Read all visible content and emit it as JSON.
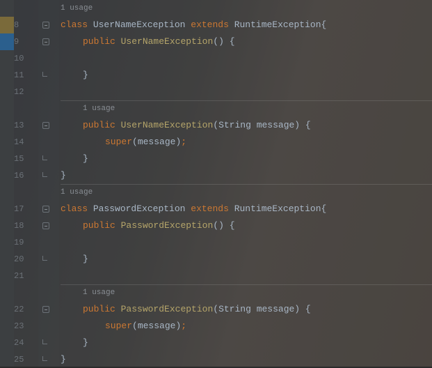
{
  "usage_label": "1 usage",
  "tokens": {
    "class": "class",
    "extends": "extends",
    "public": "public",
    "super": "super",
    "UserNameException": "UserNameException",
    "PasswordException": "PasswordException",
    "RuntimeException": "RuntimeException",
    "String": "String",
    "message": "message",
    "lparen": "(",
    "rparen": ")",
    "lbrace": "{",
    "rbrace": "}",
    "semi": ";",
    "space": " "
  },
  "line_numbers": {
    "l8": "8",
    "l9": "9",
    "l10": "10",
    "l11": "11",
    "l12": "12",
    "l13": "13",
    "l14": "14",
    "l15": "15",
    "l16": "16",
    "l17": "17",
    "l18": "18",
    "l19": "19",
    "l20": "20",
    "l21": "21",
    "l22": "22",
    "l23": "23",
    "l24": "24",
    "l25": "25"
  }
}
